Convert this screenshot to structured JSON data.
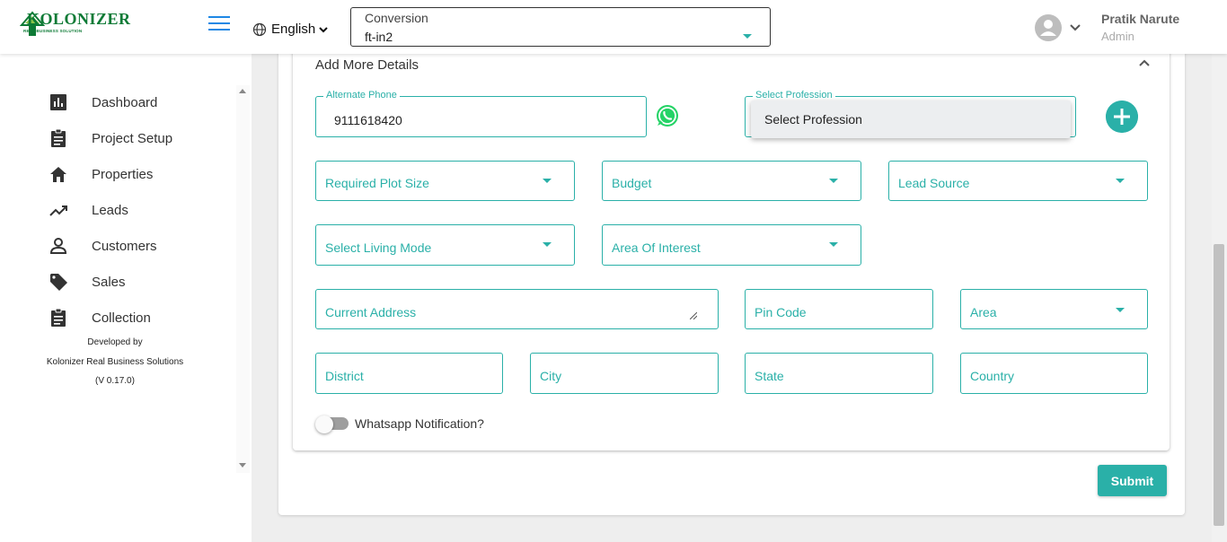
{
  "header": {
    "logo_text": "KOLONIZER",
    "logo_sub": "REAL BUSINESS SOLUTION",
    "language": "English",
    "conversion": {
      "label": "Conversion",
      "value": "ft-in2"
    },
    "user": {
      "name": "Pratik Narute",
      "role": "Admin"
    }
  },
  "sidebar": {
    "items": [
      {
        "label": "Dashboard",
        "icon": "chart-bar-icon"
      },
      {
        "label": "Project Setup",
        "icon": "clipboard-icon"
      },
      {
        "label": "Properties",
        "icon": "home-icon"
      },
      {
        "label": "Leads",
        "icon": "trending-up-icon"
      },
      {
        "label": "Customers",
        "icon": "person-icon"
      },
      {
        "label": "Sales",
        "icon": "tag-icon"
      },
      {
        "label": "Collection",
        "icon": "clipboard-icon"
      }
    ],
    "developed_by": "Developed by",
    "company": "Kolonizer Real Business Solutions",
    "version": "(V 0.17.0)"
  },
  "form": {
    "section_title": "Add More Details",
    "alternate_phone": {
      "label": "Alternate Phone",
      "value": "9111618420"
    },
    "profession": {
      "label": "Select Profession",
      "menu_option": "Select Profession"
    },
    "required_plot_size": "Required Plot Size",
    "budget": "Budget",
    "lead_source": "Lead Source",
    "living_mode": "Select Living Mode",
    "area_of_interest": "Area Of Interest",
    "current_address": "Current Address",
    "pin_code": "Pin Code",
    "area": "Area",
    "district": "District",
    "city": "City",
    "state": "State",
    "country": "Country",
    "whatsapp_notification": "Whatsapp Notification?",
    "submit": "Submit"
  },
  "colors": {
    "accent": "#2ab0a8",
    "brand_green": "#0d7a35",
    "hamburger": "#1e88e5",
    "whatsapp": "#25d366"
  }
}
